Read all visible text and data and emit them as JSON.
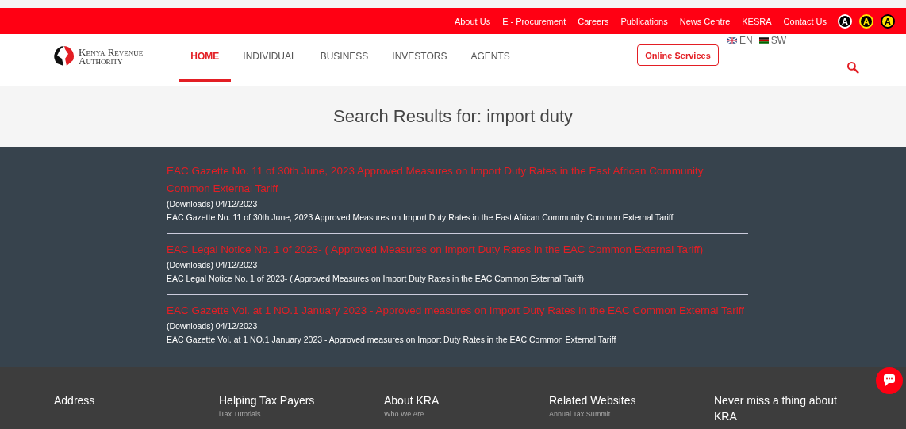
{
  "top_links": [
    "About Us",
    "E - Procurement",
    "Careers",
    "Publications",
    "News Centre",
    "KESRA",
    "Contact Us"
  ],
  "contrast_buttons": [
    {
      "label": "A",
      "kind": "dark"
    },
    {
      "label": "A",
      "kind": "yellow-dark"
    },
    {
      "label": "A",
      "kind": "yellow"
    }
  ],
  "logo": {
    "line1": "Kenya Revenue",
    "line2": "Authority"
  },
  "nav": [
    {
      "label": "HOME",
      "selected": true
    },
    {
      "label": "INDIVIDUAL",
      "selected": false
    },
    {
      "label": "BUSINESS",
      "selected": false
    },
    {
      "label": "INVESTORS",
      "selected": false
    },
    {
      "label": "AGENTS",
      "selected": false
    }
  ],
  "online_services": "Online Services",
  "languages": [
    {
      "label": "EN",
      "kind": "uk"
    },
    {
      "label": "SW",
      "kind": "kenya"
    }
  ],
  "search_title": "Search Results for: import duty",
  "results": [
    {
      "title": "EAC Gazette No. 11 of 30th June, 2023 Approved Measures on Import Duty Rates in the East African Community Common External Tariff",
      "meta": "(Downloads) 04/12/2023",
      "summary": "EAC Gazette No. 11 of 30th June, 2023 Approved Measures on Import Duty Rates in the East African Community Common External Tariff"
    },
    {
      "title": "EAC Legal Notice No. 1 of 2023- ( Approved Measures on Import Duty Rates in the EAC Common External Tariff)",
      "meta": "(Downloads) 04/12/2023",
      "summary": "EAC Legal Notice No. 1 of 2023- ( Approved Measures on Import Duty Rates in the EAC Common External Tariff)"
    },
    {
      "title": "EAC Gazette Vol. at 1 NO.1 January 2023 - Approved measures on Import Duty Rates in the EAC Common External Tariff",
      "meta": "(Downloads) 04/12/2023",
      "summary": "EAC Gazette Vol. at 1 NO.1 January 2023 - Approved measures on Import Duty Rates in the EAC Common External Tariff"
    }
  ],
  "footer": [
    {
      "heading": "Address"
    },
    {
      "heading": "Helping Tax Payers",
      "first_link": "iTax Tutorials"
    },
    {
      "heading": "About KRA",
      "first_link": "Who We Are"
    },
    {
      "heading": "Related Websites",
      "first_link": "Annual Tax Summit"
    },
    {
      "heading": "Never miss a thing about KRA"
    }
  ]
}
